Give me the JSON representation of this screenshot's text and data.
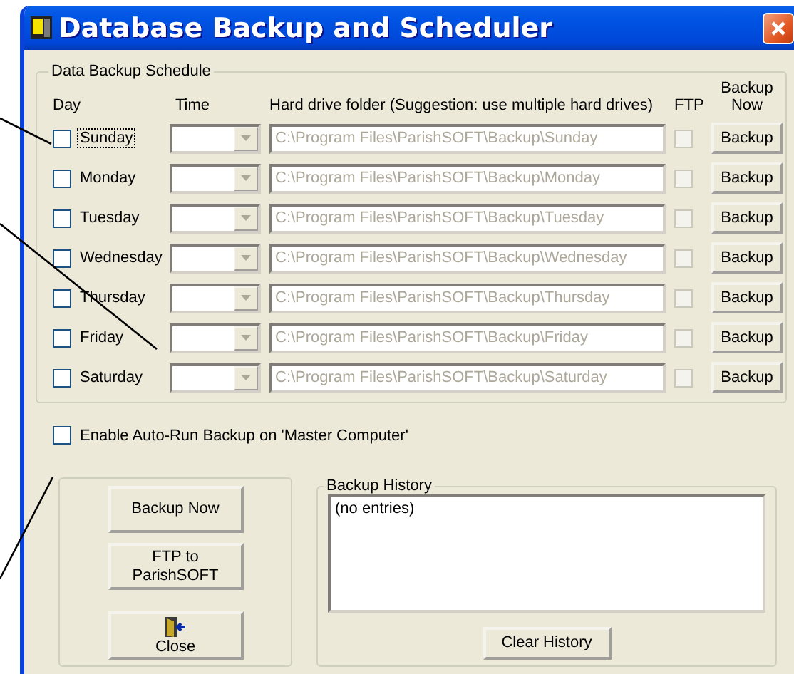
{
  "window": {
    "title": "Database Backup and Scheduler"
  },
  "schedule": {
    "title": "Data Backup Schedule",
    "columns": [
      "Day",
      "Time",
      "Hard drive folder (Suggestion: use multiple hard drives)",
      "FTP",
      "Backup Now"
    ],
    "days": [
      {
        "name": "Sunday",
        "checked": false,
        "focused": true,
        "folder": "C:\\Program Files\\ParishSOFT\\Backup\\Sunday",
        "ftp": false,
        "button": "Backup"
      },
      {
        "name": "Monday",
        "checked": false,
        "focused": false,
        "folder": "C:\\Program Files\\ParishSOFT\\Backup\\Monday",
        "ftp": false,
        "button": "Backup"
      },
      {
        "name": "Tuesday",
        "checked": false,
        "focused": false,
        "folder": "C:\\Program Files\\ParishSOFT\\Backup\\Tuesday",
        "ftp": false,
        "button": "Backup"
      },
      {
        "name": "Wednesday",
        "checked": false,
        "focused": false,
        "folder": "C:\\Program Files\\ParishSOFT\\Backup\\Wednesday",
        "ftp": false,
        "button": "Backup"
      },
      {
        "name": "Thursday",
        "checked": false,
        "focused": false,
        "folder": "C:\\Program Files\\ParishSOFT\\Backup\\Thursday",
        "ftp": false,
        "button": "Backup"
      },
      {
        "name": "Friday",
        "checked": false,
        "focused": false,
        "folder": "C:\\Program Files\\ParishSOFT\\Backup\\Friday",
        "ftp": false,
        "button": "Backup"
      },
      {
        "name": "Saturday",
        "checked": false,
        "focused": false,
        "folder": "C:\\Program Files\\ParishSOFT\\Backup\\Saturday",
        "ftp": false,
        "button": "Backup"
      }
    ]
  },
  "auto_run": {
    "label": "Enable Auto-Run Backup on 'Master Computer'",
    "checked": false
  },
  "actions": [
    {
      "kind": "text",
      "label": "Backup Now"
    },
    {
      "kind": "text",
      "label": "FTP to ParishSOFT"
    },
    {
      "kind": "icon",
      "label": "Close"
    }
  ],
  "history": {
    "title": "Backup History",
    "entries": [
      "(no entries)"
    ],
    "clear_button": "Clear History"
  }
}
